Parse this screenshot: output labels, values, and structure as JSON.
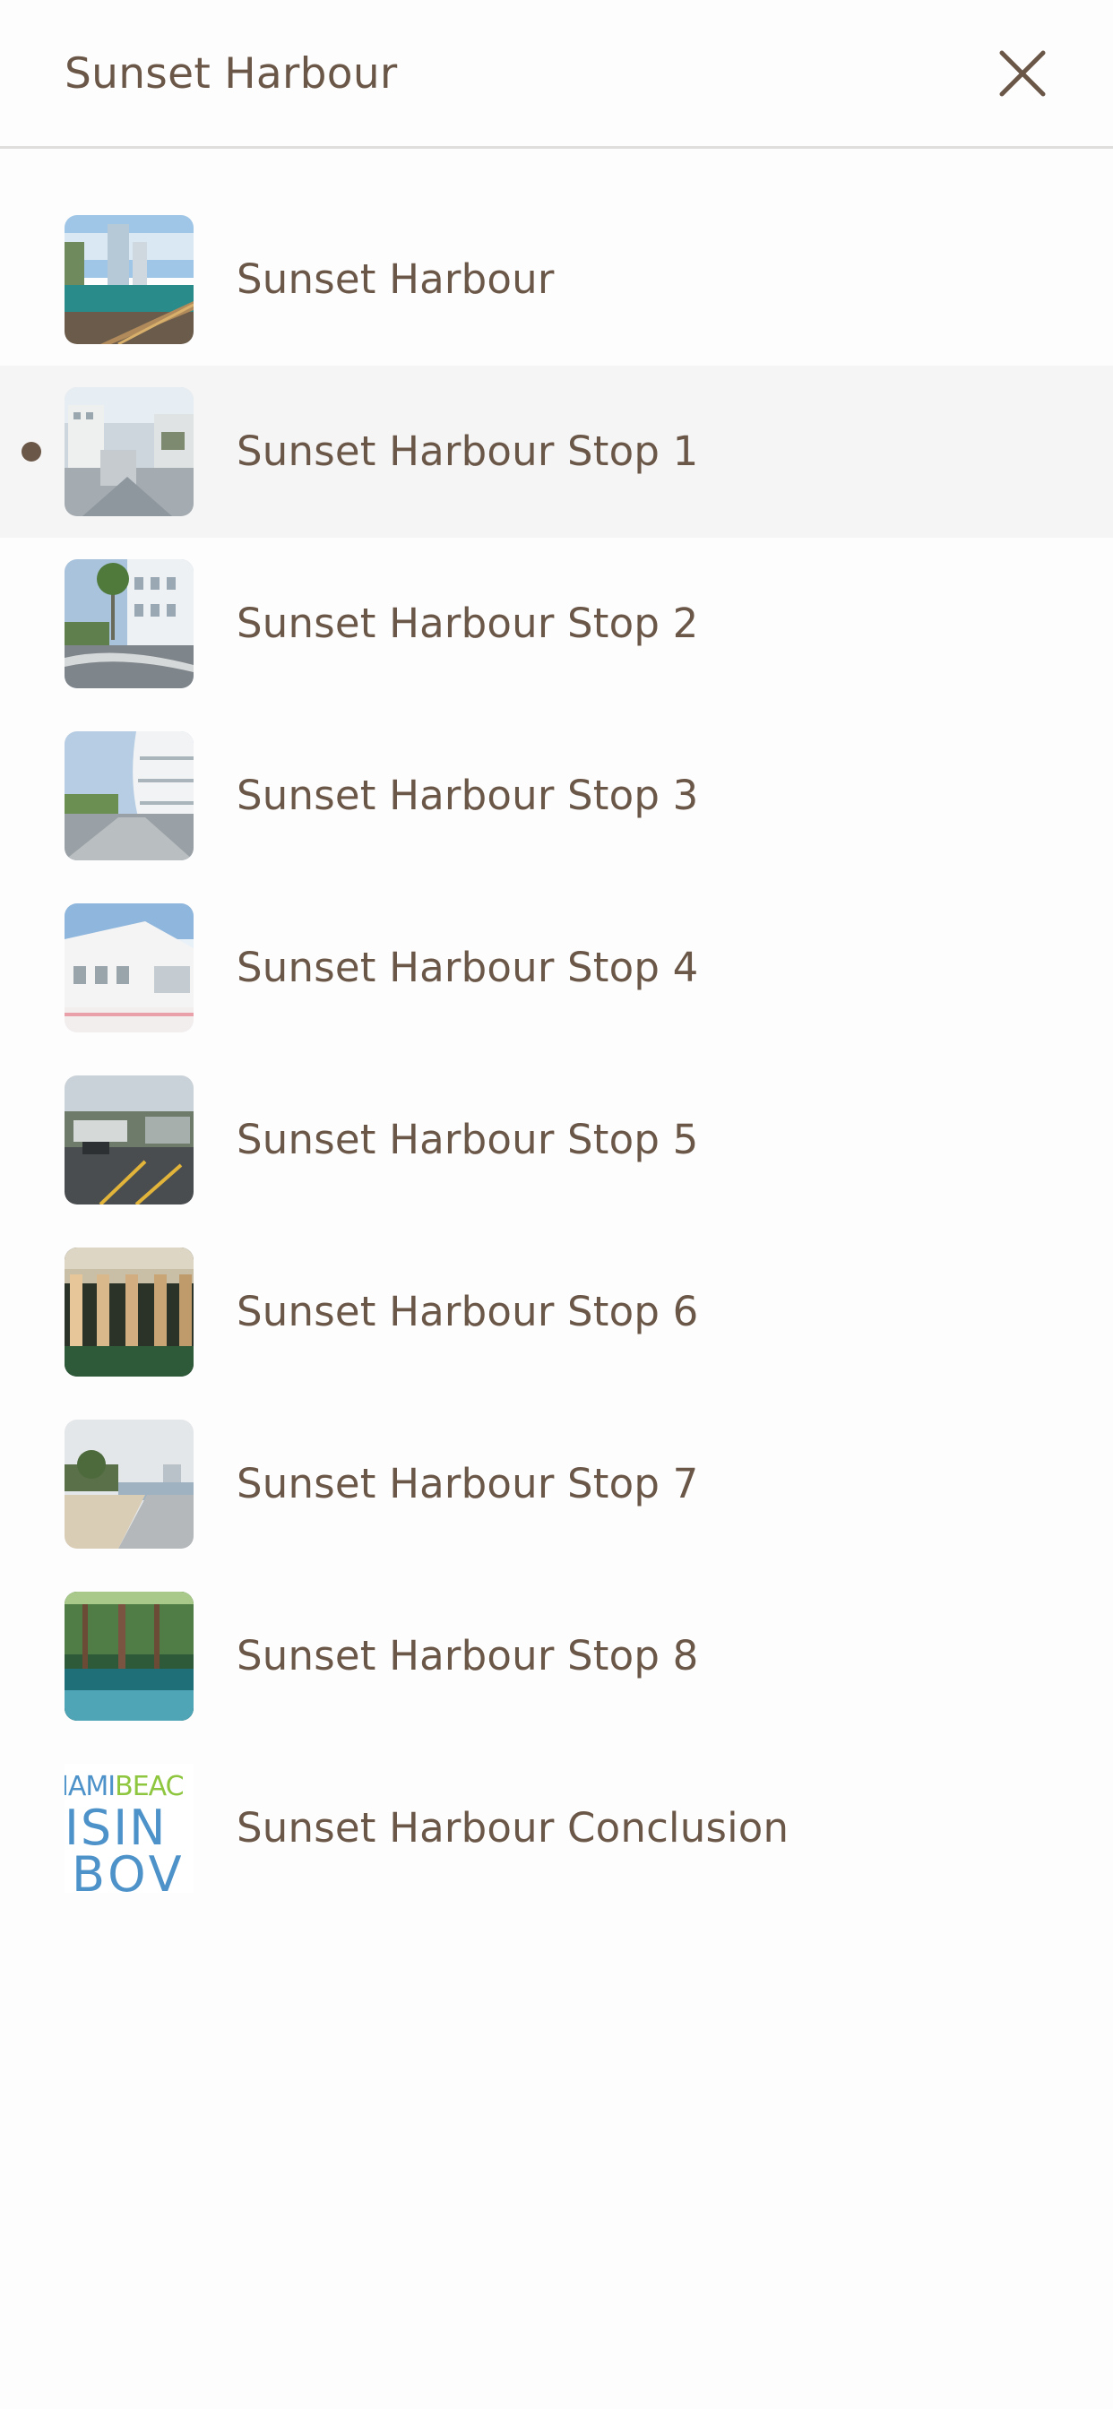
{
  "header": {
    "title": "Sunset Harbour",
    "close_icon": "close-icon"
  },
  "list": {
    "active_index": 1,
    "items": [
      {
        "label": "Sunset Harbour"
      },
      {
        "label": "Sunset Harbour Stop 1"
      },
      {
        "label": "Sunset Harbour Stop 2"
      },
      {
        "label": "Sunset Harbour Stop 3"
      },
      {
        "label": "Sunset Harbour Stop 4"
      },
      {
        "label": "Sunset Harbour Stop 5"
      },
      {
        "label": "Sunset Harbour Stop 6"
      },
      {
        "label": "Sunset Harbour Stop 7"
      },
      {
        "label": "Sunset Harbour Stop 8"
      },
      {
        "label": "Sunset Harbour Conclusion"
      }
    ]
  },
  "conclusion_logo": {
    "line1_a": "IAMI",
    "line1_b": "BEAC",
    "line2": "ISIN",
    "line3": "BOV"
  },
  "colors": {
    "text": "#6a5748",
    "active_row_bg": "#f6f5f5",
    "divider": "#e0dedd",
    "logo_blue": "#4d92c9",
    "logo_green": "#8ec63f"
  }
}
